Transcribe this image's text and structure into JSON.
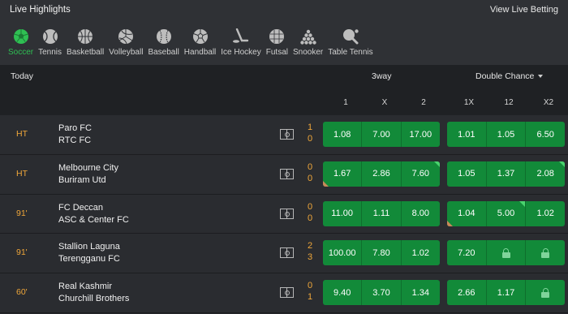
{
  "header": {
    "title": "Live Highlights",
    "link": "View Live Betting"
  },
  "sports": [
    {
      "label": "Soccer",
      "icon": "soccer-ball-icon",
      "active": true
    },
    {
      "label": "Tennis",
      "icon": "tennis-ball-icon",
      "active": false
    },
    {
      "label": "Basketball",
      "icon": "basketball-icon",
      "active": false
    },
    {
      "label": "Volleyball",
      "icon": "volleyball-icon",
      "active": false
    },
    {
      "label": "Baseball",
      "icon": "baseball-icon",
      "active": false
    },
    {
      "label": "Handball",
      "icon": "handball-icon",
      "active": false
    },
    {
      "label": "Ice Hockey",
      "icon": "ice-hockey-icon",
      "active": false
    },
    {
      "label": "Futsal",
      "icon": "futsal-ball-icon",
      "active": false
    },
    {
      "label": "Snooker",
      "icon": "snooker-icon",
      "active": false
    },
    {
      "label": "Table Tennis",
      "icon": "table-tennis-icon",
      "active": false
    }
  ],
  "markets": {
    "today": "Today",
    "three_way": "3way",
    "double_chance": "Double Chance",
    "cols_3way": [
      "1",
      "X",
      "2"
    ],
    "cols_dc": [
      "1X",
      "12",
      "X2"
    ]
  },
  "matches": [
    {
      "time": "HT",
      "home": "Paro FC",
      "away": "RTC FC",
      "home_score": "1",
      "away_score": "0",
      "odds_3way": [
        {
          "v": "1.08"
        },
        {
          "v": "7.00"
        },
        {
          "v": "17.00"
        }
      ],
      "odds_dc": [
        {
          "v": "1.01"
        },
        {
          "v": "1.05"
        },
        {
          "v": "6.50"
        }
      ]
    },
    {
      "time": "HT",
      "home": "Melbourne City",
      "away": "Buriram Utd",
      "home_score": "0",
      "away_score": "0",
      "odds_3way": [
        {
          "v": "1.67",
          "down": true
        },
        {
          "v": "2.86"
        },
        {
          "v": "7.60",
          "up": true
        }
      ],
      "odds_dc": [
        {
          "v": "1.05"
        },
        {
          "v": "1.37"
        },
        {
          "v": "2.08",
          "up": true
        }
      ]
    },
    {
      "time": "91'",
      "home": "FC Deccan",
      "away": "ASC & Center FC",
      "home_score": "0",
      "away_score": "0",
      "odds_3way": [
        {
          "v": "11.00"
        },
        {
          "v": "1.11"
        },
        {
          "v": "8.00"
        }
      ],
      "odds_dc": [
        {
          "v": "1.04",
          "down": true
        },
        {
          "v": "5.00",
          "up": true
        },
        {
          "v": "1.02"
        }
      ]
    },
    {
      "time": "91'",
      "home": "Stallion Laguna",
      "away": "Terengganu FC",
      "home_score": "2",
      "away_score": "3",
      "odds_3way": [
        {
          "v": "100.00"
        },
        {
          "v": "7.80"
        },
        {
          "v": "1.02"
        }
      ],
      "odds_dc": [
        {
          "v": "7.20"
        },
        {
          "v": "",
          "locked": true
        },
        {
          "v": "",
          "locked": true
        }
      ]
    },
    {
      "time": "60'",
      "home": "Real Kashmir",
      "away": "Churchill Brothers",
      "home_score": "0",
      "away_score": "1",
      "odds_3way": [
        {
          "v": "9.40"
        },
        {
          "v": "3.70"
        },
        {
          "v": "1.34"
        }
      ],
      "odds_dc": [
        {
          "v": "2.66"
        },
        {
          "v": "1.17"
        },
        {
          "v": "",
          "locked": true
        }
      ]
    }
  ],
  "colors": {
    "accent": "#2fbf53",
    "odds_bg": "#128a39",
    "score": "#f0a73a",
    "up": "#49d36e",
    "down": "#c9895a"
  }
}
